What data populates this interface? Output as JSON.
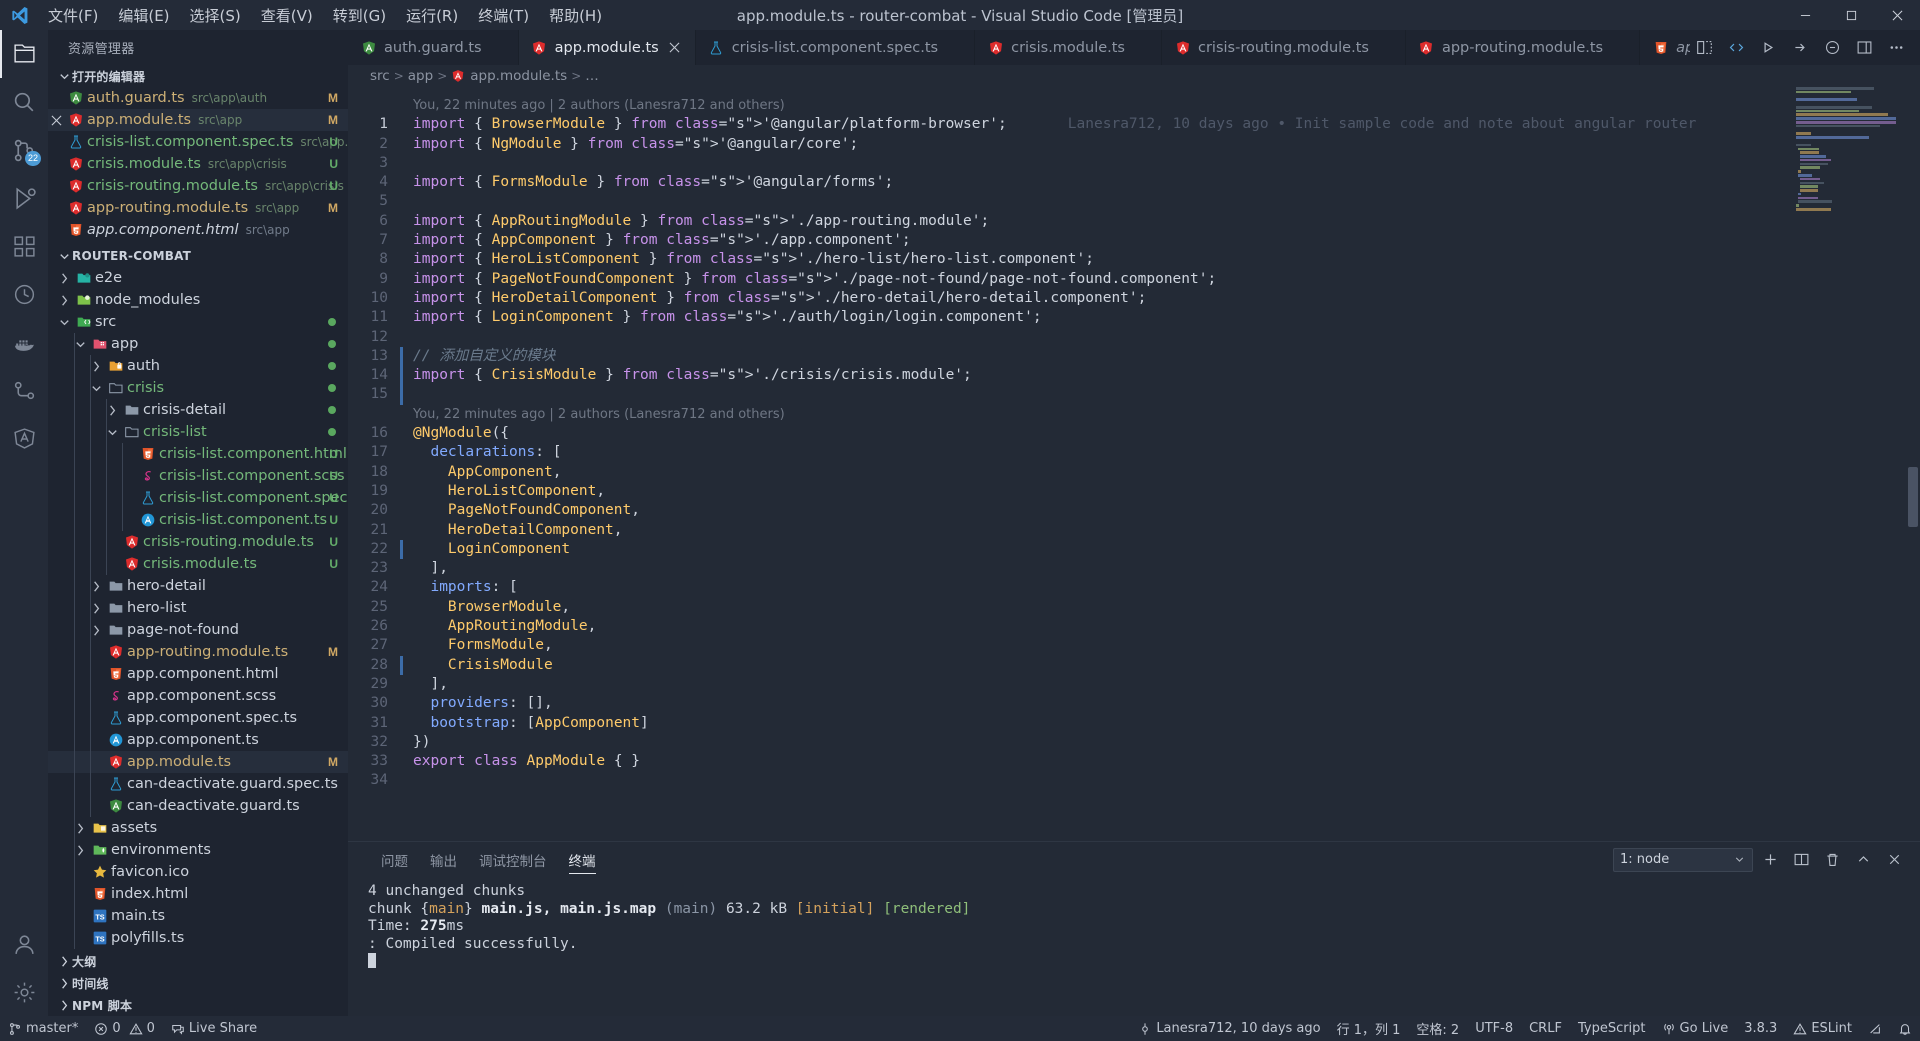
{
  "titlebar": {
    "logo_icon": "vscode-logo-icon",
    "title": "app.module.ts - router-combat - Visual Studio Code [管理员]",
    "menus": [
      {
        "label": "文件(F)",
        "name": "menu-file"
      },
      {
        "label": "编辑(E)",
        "name": "menu-edit"
      },
      {
        "label": "选择(S)",
        "name": "menu-selection"
      },
      {
        "label": "查看(V)",
        "name": "menu-view"
      },
      {
        "label": "转到(G)",
        "name": "menu-goto"
      },
      {
        "label": "运行(R)",
        "name": "menu-run"
      },
      {
        "label": "终端(T)",
        "name": "menu-terminal"
      },
      {
        "label": "帮助(H)",
        "name": "menu-help"
      }
    ],
    "window_controls": [
      "minimize-icon",
      "maximize-icon",
      "close-icon"
    ]
  },
  "activitybar": {
    "items": [
      {
        "name": "explorer-icon",
        "active": true,
        "badge": ""
      },
      {
        "name": "search-icon",
        "active": false,
        "badge": ""
      },
      {
        "name": "source-control-icon",
        "active": false,
        "badge": "22"
      },
      {
        "name": "run-debug-icon",
        "active": false,
        "badge": ""
      },
      {
        "name": "extensions-icon",
        "active": false,
        "badge": ""
      },
      {
        "name": "test-beaker-icon",
        "active": false,
        "badge": ""
      },
      {
        "name": "docker-icon",
        "active": false,
        "badge": ""
      },
      {
        "name": "remote-explorer-icon",
        "active": false,
        "badge": ""
      },
      {
        "name": "angular-icon",
        "active": false,
        "badge": ""
      }
    ],
    "bottom_items": [
      {
        "name": "accounts-icon"
      },
      {
        "name": "settings-gear-icon"
      }
    ]
  },
  "sidebar": {
    "title": "资源管理器",
    "open_editors": {
      "header": "打开的编辑器",
      "items": [
        {
          "name": "auth.guard.ts",
          "desc": "src\\app\\auth",
          "icon": "angular-guard-icon",
          "badge": "M",
          "badge_kind": "mod",
          "active": false,
          "italic": false
        },
        {
          "name": "app.module.ts",
          "desc": "src\\app",
          "icon": "angular-module-icon",
          "badge": "M",
          "badge_kind": "mod",
          "active": true,
          "italic": false,
          "close": true
        },
        {
          "name": "crisis-list.component.spec.ts",
          "desc": "src\\app...",
          "icon": "test-beaker-icon",
          "badge": "U",
          "badge_kind": "unt",
          "active": false,
          "italic": false
        },
        {
          "name": "crisis.module.ts",
          "desc": "src\\app\\crisis",
          "icon": "angular-module-icon",
          "badge": "U",
          "badge_kind": "unt",
          "active": false,
          "italic": false
        },
        {
          "name": "crisis-routing.module.ts",
          "desc": "src\\app\\crisis",
          "icon": "angular-module-icon",
          "badge": "U",
          "badge_kind": "unt",
          "active": false,
          "italic": false
        },
        {
          "name": "app-routing.module.ts",
          "desc": "src\\app",
          "icon": "angular-module-icon",
          "badge": "M",
          "badge_kind": "mod",
          "active": false,
          "italic": false
        },
        {
          "name": "app.component.html",
          "desc": "src\\app",
          "icon": "html5-icon",
          "badge": "",
          "badge_kind": "",
          "active": false,
          "italic": true
        }
      ]
    },
    "project": {
      "header": "ROUTER-COMBAT",
      "tree": [
        {
          "label": "e2e",
          "depth": 1,
          "type": "folder",
          "arrow": "right",
          "icon": "folder-e2e-icon",
          "badge": "",
          "dot": false
        },
        {
          "label": "node_modules",
          "depth": 1,
          "type": "folder",
          "arrow": "right",
          "icon": "folder-node-icon",
          "badge": "",
          "dot": false
        },
        {
          "label": "src",
          "depth": 1,
          "type": "folder",
          "arrow": "down",
          "icon": "folder-src-icon",
          "badge": "",
          "dot": true
        },
        {
          "label": "app",
          "depth": 2,
          "type": "folder",
          "arrow": "down",
          "icon": "folder-app-icon",
          "badge": "",
          "dot": true
        },
        {
          "label": "auth",
          "depth": 3,
          "type": "folder",
          "arrow": "right",
          "icon": "folder-auth-icon",
          "badge": "",
          "dot": true
        },
        {
          "label": "crisis",
          "depth": 3,
          "type": "folder",
          "arrow": "down",
          "icon": "folder-open-icon",
          "badge": "",
          "dot": true,
          "green": true
        },
        {
          "label": "crisis-detail",
          "depth": 4,
          "type": "folder",
          "arrow": "right",
          "icon": "folder-icon",
          "badge": "",
          "dot": true
        },
        {
          "label": "crisis-list",
          "depth": 4,
          "type": "folder",
          "arrow": "down",
          "icon": "folder-open-icon",
          "badge": "",
          "dot": true,
          "green": true
        },
        {
          "label": "crisis-list.component.html",
          "depth": 5,
          "type": "file",
          "arrow": "",
          "icon": "html5-icon",
          "badge": "U",
          "badge_kind": "unt",
          "green": true
        },
        {
          "label": "crisis-list.component.scss",
          "depth": 5,
          "type": "file",
          "arrow": "",
          "icon": "sass-icon",
          "badge": "U",
          "badge_kind": "unt",
          "green": true
        },
        {
          "label": "crisis-list.component.spec.ts",
          "depth": 5,
          "type": "file",
          "arrow": "",
          "icon": "test-beaker-icon",
          "badge": "U",
          "badge_kind": "unt",
          "green": true
        },
        {
          "label": "crisis-list.component.ts",
          "depth": 5,
          "type": "file",
          "arrow": "",
          "icon": "angular-component-icon",
          "badge": "U",
          "badge_kind": "unt",
          "green": true
        },
        {
          "label": "crisis-routing.module.ts",
          "depth": 4,
          "type": "file",
          "arrow": "",
          "icon": "angular-module-icon",
          "badge": "U",
          "badge_kind": "unt",
          "green": true
        },
        {
          "label": "crisis.module.ts",
          "depth": 4,
          "type": "file",
          "arrow": "",
          "icon": "angular-module-icon",
          "badge": "U",
          "badge_kind": "unt",
          "green": true
        },
        {
          "label": "hero-detail",
          "depth": 3,
          "type": "folder",
          "arrow": "right",
          "icon": "folder-icon",
          "badge": ""
        },
        {
          "label": "hero-list",
          "depth": 3,
          "type": "folder",
          "arrow": "right",
          "icon": "folder-icon",
          "badge": ""
        },
        {
          "label": "page-not-found",
          "depth": 3,
          "type": "folder",
          "arrow": "right",
          "icon": "folder-icon",
          "badge": ""
        },
        {
          "label": "app-routing.module.ts",
          "depth": 3,
          "type": "file",
          "arrow": "",
          "icon": "angular-module-icon",
          "badge": "M",
          "badge_kind": "mod",
          "mod": true
        },
        {
          "label": "app.component.html",
          "depth": 3,
          "type": "file",
          "arrow": "",
          "icon": "html5-icon",
          "badge": ""
        },
        {
          "label": "app.component.scss",
          "depth": 3,
          "type": "file",
          "arrow": "",
          "icon": "sass-icon",
          "badge": ""
        },
        {
          "label": "app.component.spec.ts",
          "depth": 3,
          "type": "file",
          "arrow": "",
          "icon": "test-beaker-icon",
          "badge": ""
        },
        {
          "label": "app.component.ts",
          "depth": 3,
          "type": "file",
          "arrow": "",
          "icon": "angular-component-icon",
          "badge": ""
        },
        {
          "label": "app.module.ts",
          "depth": 3,
          "type": "file",
          "arrow": "",
          "icon": "angular-module-icon",
          "badge": "M",
          "badge_kind": "mod",
          "selected": true,
          "mod": true
        },
        {
          "label": "can-deactivate.guard.spec.ts",
          "depth": 3,
          "type": "file",
          "arrow": "",
          "icon": "test-beaker-icon",
          "badge": ""
        },
        {
          "label": "can-deactivate.guard.ts",
          "depth": 3,
          "type": "file",
          "arrow": "",
          "icon": "angular-guard-icon",
          "badge": ""
        },
        {
          "label": "assets",
          "depth": 2,
          "type": "folder",
          "arrow": "right",
          "icon": "folder-assets-icon",
          "badge": ""
        },
        {
          "label": "environments",
          "depth": 2,
          "type": "folder",
          "arrow": "right",
          "icon": "folder-env-icon",
          "badge": ""
        },
        {
          "label": "favicon.ico",
          "depth": 2,
          "type": "file",
          "arrow": "",
          "icon": "favicon-icon",
          "badge": ""
        },
        {
          "label": "index.html",
          "depth": 2,
          "type": "file",
          "arrow": "",
          "icon": "html5-icon",
          "badge": ""
        },
        {
          "label": "main.ts",
          "depth": 2,
          "type": "file",
          "arrow": "",
          "icon": "typescript-icon",
          "badge": ""
        },
        {
          "label": "polyfills.ts",
          "depth": 2,
          "type": "file",
          "arrow": "",
          "icon": "typescript-icon",
          "badge": ""
        }
      ]
    },
    "collapsed_sections": [
      {
        "label": "大纲",
        "name": "outline-section"
      },
      {
        "label": "时间线",
        "name": "timeline-section"
      },
      {
        "label": "NPM 脚本",
        "name": "npm-scripts-section"
      }
    ]
  },
  "tabs": [
    {
      "label": "auth.guard.ts",
      "icon": "angular-guard-icon",
      "active": false,
      "italic": false,
      "close": false
    },
    {
      "label": "app.module.ts",
      "icon": "angular-module-icon",
      "active": true,
      "italic": false,
      "close": true
    },
    {
      "label": "crisis-list.component.spec.ts",
      "icon": "test-beaker-icon",
      "active": false,
      "italic": false,
      "close": false
    },
    {
      "label": "crisis.module.ts",
      "icon": "angular-module-icon",
      "active": false,
      "italic": false,
      "close": false
    },
    {
      "label": "crisis-routing.module.ts",
      "icon": "angular-module-icon",
      "active": false,
      "italic": false,
      "close": false
    },
    {
      "label": "app-routing.module.ts",
      "icon": "angular-module-icon",
      "active": false,
      "italic": false,
      "close": false
    },
    {
      "label": "app.component.html",
      "icon": "html5-icon",
      "active": false,
      "italic": true,
      "close": false
    }
  ],
  "tab_actions": [
    "split-editor-icon",
    "live-share-icon",
    "debug-start-icon",
    "debug-step-icon",
    "debug-console-icon",
    "layout-icon",
    "more-actions-icon"
  ],
  "breadcrumbs": [
    {
      "label": "src",
      "icon": ""
    },
    {
      "label": "app",
      "icon": ""
    },
    {
      "label": "app.module.ts",
      "icon": "angular-module-icon"
    },
    {
      "label": "…",
      "icon": ""
    }
  ],
  "editor": {
    "codelens_top": "You, 22 minutes ago | 2 authors (Lanesra712 and others)",
    "codelens_mid": "You, 22 minutes ago | 2 authors (Lanesra712 and others)",
    "inline_blame": "Lanesra712, 10 days ago • Init sample code and note about angular router",
    "first_line_number": 1,
    "total_lines": 34,
    "lines": [
      {
        "n": 1,
        "text": "import { BrowserModule } from '@angular/platform-browser';"
      },
      {
        "n": 2,
        "text": "import { NgModule } from '@angular/core';"
      },
      {
        "n": 3,
        "text": ""
      },
      {
        "n": 4,
        "text": "import { FormsModule } from '@angular/forms';"
      },
      {
        "n": 5,
        "text": ""
      },
      {
        "n": 6,
        "text": "import { AppRoutingModule } from './app-routing.module';"
      },
      {
        "n": 7,
        "text": "import { AppComponent } from './app.component';"
      },
      {
        "n": 8,
        "text": "import { HeroListComponent } from './hero-list/hero-list.component';"
      },
      {
        "n": 9,
        "text": "import { PageNotFoundComponent } from './page-not-found/page-not-found.component';"
      },
      {
        "n": 10,
        "text": "import { HeroDetailComponent } from './hero-detail/hero-detail.component';"
      },
      {
        "n": 11,
        "text": "import { LoginComponent } from './auth/login/login.component';"
      },
      {
        "n": 12,
        "text": ""
      },
      {
        "n": 13,
        "text": "// 添加自定义的模块"
      },
      {
        "n": 14,
        "text": "import { CrisisModule } from './crisis/crisis.module';"
      },
      {
        "n": 15,
        "text": ""
      },
      {
        "n": 16,
        "text": "@NgModule({"
      },
      {
        "n": 17,
        "text": "  declarations: ["
      },
      {
        "n": 18,
        "text": "    AppComponent,"
      },
      {
        "n": 19,
        "text": "    HeroListComponent,"
      },
      {
        "n": 20,
        "text": "    PageNotFoundComponent,"
      },
      {
        "n": 21,
        "text": "    HeroDetailComponent,"
      },
      {
        "n": 22,
        "text": "    LoginComponent"
      },
      {
        "n": 23,
        "text": "  ],"
      },
      {
        "n": 24,
        "text": "  imports: ["
      },
      {
        "n": 25,
        "text": "    BrowserModule,"
      },
      {
        "n": 26,
        "text": "    AppRoutingModule,"
      },
      {
        "n": 27,
        "text": "    FormsModule,"
      },
      {
        "n": 28,
        "text": "    CrisisModule"
      },
      {
        "n": 29,
        "text": "  ],"
      },
      {
        "n": 30,
        "text": "  providers: [],"
      },
      {
        "n": 31,
        "text": "  bootstrap: [AppComponent]"
      },
      {
        "n": 32,
        "text": "})"
      },
      {
        "n": 33,
        "text": "export class AppModule { }"
      },
      {
        "n": 34,
        "text": ""
      }
    ]
  },
  "panel": {
    "tabs": [
      {
        "label": "问题",
        "active": false,
        "name": "panel-tab-problems"
      },
      {
        "label": "输出",
        "active": false,
        "name": "panel-tab-output"
      },
      {
        "label": "调试控制台",
        "active": false,
        "name": "panel-tab-debug-console"
      },
      {
        "label": "终端",
        "active": true,
        "name": "panel-tab-terminal"
      }
    ],
    "terminal_selected": "1: node",
    "actions": [
      "new-terminal-icon",
      "split-terminal-icon",
      "kill-terminal-icon",
      "maximize-panel-icon",
      "close-panel-icon"
    ],
    "terminal_lines": [
      "4 unchanged chunks",
      "chunk {main} main.js, main.js.map (main) 63.2 kB [initial] [rendered]",
      "Time: 275ms",
      ": Compiled successfully."
    ],
    "terminal_line2": {
      "pre": "chunk {",
      "main1": "main",
      "mid": "} ",
      "files": "main.js, main.js.map",
      "paren": " (main) ",
      "size": "63.2 kB ",
      "initial": "[initial]",
      "rendered": "[rendered]"
    },
    "terminal_time": {
      "label": "Time: ",
      "value": "275",
      "unit": "ms"
    }
  },
  "statusbar": {
    "left": [
      {
        "label": "master*",
        "icon": "source-control-branch-icon",
        "name": "status-branch"
      },
      {
        "label": "0",
        "label2": "0",
        "icon": "error-warning-icon",
        "name": "status-problems"
      },
      {
        "label": "Live Share",
        "icon": "live-share-icon",
        "name": "status-live-share"
      }
    ],
    "problems": {
      "errors": "0",
      "warnings": "0"
    },
    "right": [
      {
        "label": "Lanesra712, 10 days ago",
        "icon": "git-blame-icon",
        "name": "status-git-blame"
      },
      {
        "label": "行 1，列 1",
        "icon": "",
        "name": "status-cursor-position"
      },
      {
        "label": "空格: 2",
        "icon": "",
        "name": "status-indentation"
      },
      {
        "label": "UTF-8",
        "icon": "",
        "name": "status-encoding"
      },
      {
        "label": "CRLF",
        "icon": "",
        "name": "status-eol"
      },
      {
        "label": "TypeScript",
        "icon": "",
        "name": "status-language-mode"
      },
      {
        "label": "Go Live",
        "icon": "broadcast-icon",
        "name": "status-go-live"
      },
      {
        "label": "3.8.3",
        "icon": "",
        "name": "status-ts-version"
      },
      {
        "label": "ESLint",
        "icon": "warning-triangle-icon",
        "name": "status-eslint"
      },
      {
        "label": "",
        "icon": "feedback-icon",
        "name": "status-feedback"
      },
      {
        "label": "",
        "icon": "bell-icon",
        "name": "status-notifications"
      }
    ]
  },
  "colors": {
    "accent": "#4d9cd6",
    "bg_titlebar": "#242b38",
    "bg_sidebar": "#1e2430",
    "bg_editor": "#232a36",
    "modified": "#d0a864",
    "untracked": "#64ad6a",
    "string": "#c3e88d",
    "keyword": "#c792ea",
    "type": "#ffcb6b"
  }
}
